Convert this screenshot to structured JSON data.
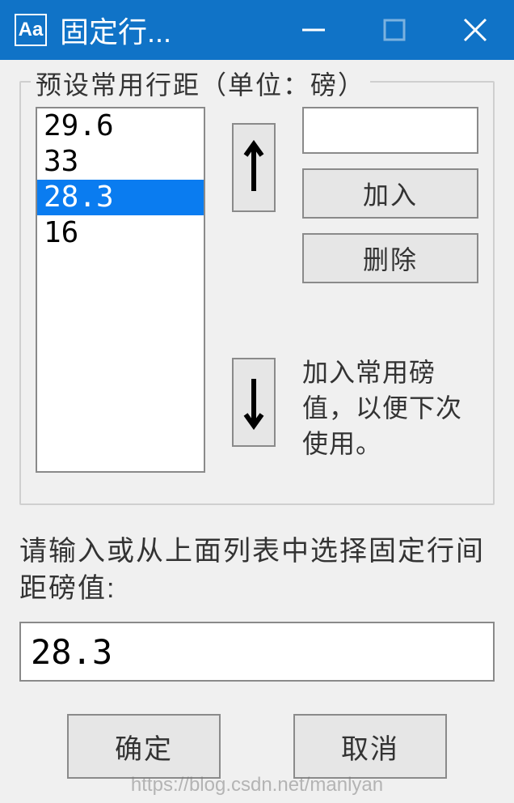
{
  "window": {
    "title": "固定行...",
    "icon_text": "Aa"
  },
  "group": {
    "legend": "预设常用行距（单位：磅）",
    "list_items": [
      "29.6",
      "33",
      "28.3",
      "16"
    ],
    "selected_index": 2,
    "add_input_value": "",
    "add_button": "加入",
    "delete_button": "删除",
    "hint": "加入常用磅值，以便下次使用。"
  },
  "prompt": "请输入或从上面列表中选择固定行间距磅值:",
  "main_input_value": "28.3",
  "ok_button": "确定",
  "cancel_button": "取消",
  "watermark": "https://blog.csdn.net/manlyan"
}
